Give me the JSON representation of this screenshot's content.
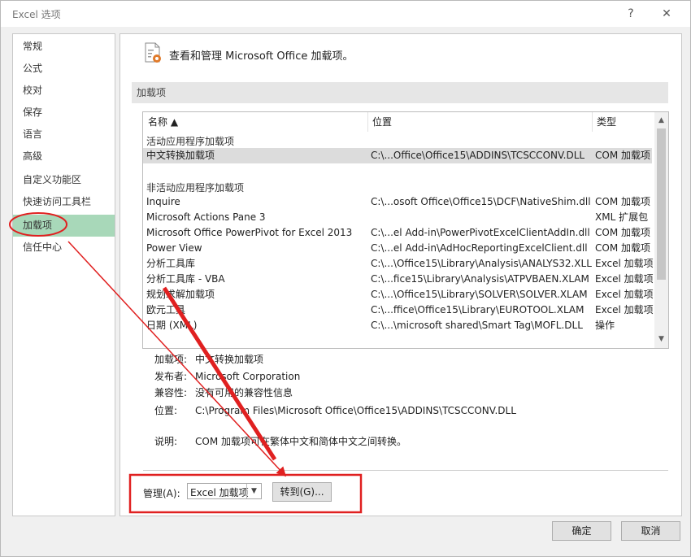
{
  "dialog": {
    "title": "Excel 选项",
    "help": "?",
    "close": "✕"
  },
  "sidebar": {
    "items": [
      {
        "label": "常规"
      },
      {
        "label": "公式"
      },
      {
        "label": "校对"
      },
      {
        "label": "保存"
      },
      {
        "label": "语言"
      },
      {
        "label": "高级"
      },
      {
        "label": "自定义功能区"
      },
      {
        "label": "快速访问工具栏"
      },
      {
        "label": "加载项"
      },
      {
        "label": "信任中心"
      }
    ],
    "active_index": 8
  },
  "main": {
    "header": "查看和管理 Microsoft Office 加载项。",
    "section": "加载项",
    "columns": {
      "name": "名称 ▲",
      "location": "位置",
      "type": "类型"
    },
    "active_group": "活动应用程序加载项",
    "inactive_group": "非活动应用程序加载项",
    "active_rows": [
      {
        "name": "中文转换加载项",
        "location": "C:\\...Office\\Office15\\ADDINS\\TCSCCONV.DLL",
        "type": "COM 加载项"
      }
    ],
    "inactive_rows": [
      {
        "name": "Inquire",
        "location": "C:\\...osoft Office\\Office15\\DCF\\NativeShim.dll",
        "type": "COM 加载项"
      },
      {
        "name": "Microsoft Actions Pane 3",
        "location": "",
        "type": "XML 扩展包"
      },
      {
        "name": "Microsoft Office PowerPivot for Excel 2013",
        "location": "C:\\...el Add-in\\PowerPivotExcelClientAddIn.dll",
        "type": "COM 加载项"
      },
      {
        "name": "Power View",
        "location": "C:\\...el Add-in\\AdHocReportingExcelClient.dll",
        "type": "COM 加载项"
      },
      {
        "name": "分析工具库",
        "location": "C:\\...\\Office15\\Library\\Analysis\\ANALYS32.XLL",
        "type": "Excel 加载项"
      },
      {
        "name": "分析工具库 - VBA",
        "location": "C:\\...fice15\\Library\\Analysis\\ATPVBAEN.XLAM",
        "type": "Excel 加载项"
      },
      {
        "name": "规划求解加载项",
        "location": "C:\\...\\Office15\\Library\\SOLVER\\SOLVER.XLAM",
        "type": "Excel 加载项"
      },
      {
        "name": "欧元工具",
        "location": "C:\\...ffice\\Office15\\Library\\EUROTOOL.XLAM",
        "type": "Excel 加载项"
      },
      {
        "name": "日期 (XML)",
        "location": "C:\\...\\microsoft shared\\Smart Tag\\MOFL.DLL",
        "type": "操作"
      }
    ],
    "details": {
      "addin_label": "加载项:",
      "addin": "中文转换加载项",
      "publisher_label": "发布者:",
      "publisher": "Microsoft Corporation",
      "compat_label": "兼容性:",
      "compat": "没有可用的兼容性信息",
      "location_label": "位置:",
      "location": "C:\\Program Files\\Microsoft Office\\Office15\\ADDINS\\TCSCCONV.DLL",
      "desc_label": "说明:",
      "desc": "COM 加载项可在繁体中文和简体中文之间转换。"
    },
    "manage": {
      "label": "管理(A):",
      "selected": "Excel 加载项",
      "go": "转到(G)..."
    }
  },
  "buttons": {
    "ok": "确定",
    "cancel": "取消"
  },
  "colors": {
    "annotation": "#e02020",
    "active_item": "#a8d8b9"
  }
}
